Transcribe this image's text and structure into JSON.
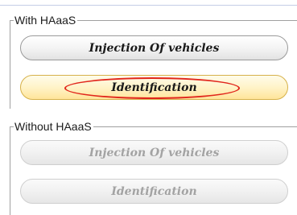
{
  "groups": {
    "with": {
      "title": "With HAaaS",
      "injection_label": "Injection Of vehicles",
      "identification_label": "Identification"
    },
    "without": {
      "title": "Without HAaaS",
      "injection_label": "Injection Of vehicles",
      "identification_label": "Identification"
    }
  },
  "colors": {
    "highlight": "#e1261c",
    "selected_border": "#d6b14a",
    "disabled_text": "#a3a3a3"
  }
}
